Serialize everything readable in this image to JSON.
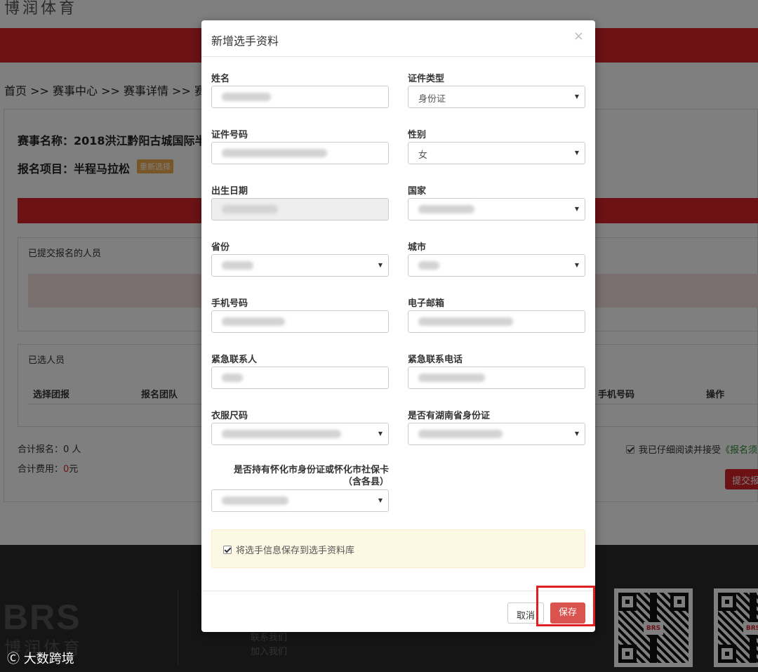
{
  "site": {
    "logo_top": "博润体育",
    "breadcrumb": "首页 >> 赛事中心 >> 赛事详情 >> 赛",
    "event_name": "赛事名称：2018洪江黔阳古城国际半",
    "event_item": "报名项目：半程马拉松",
    "reselect_label": "重新选择",
    "submitted_title": "已提交报名的人员",
    "selected_title": "已选人员",
    "table_headers": [
      "选择团报",
      "报名团队",
      "手机号码",
      "操作"
    ],
    "total_count": "合计报名：0 人",
    "total_fee_label": "合计费用：",
    "total_fee_value": "0",
    "total_fee_unit": "元",
    "agree_text": "我已仔细阅读并接受",
    "agree_link": "《报名须",
    "submit_label": "提交报",
    "footer_logo": "BRS",
    "footer_logo_cn": "博润体育",
    "footer_links": [
      "联系我们",
      "加入我们"
    ],
    "qr_badge": "BRS",
    "watermark": "大数跨境"
  },
  "modal": {
    "title": "新增选手资料",
    "close_icon": "×",
    "fields": {
      "name": {
        "label": "姓名"
      },
      "id_type": {
        "label": "证件类型",
        "value": "身份证"
      },
      "id_number": {
        "label": "证件号码"
      },
      "gender": {
        "label": "性别",
        "value": "女"
      },
      "birthdate": {
        "label": "出生日期"
      },
      "country": {
        "label": "国家"
      },
      "province": {
        "label": "省份"
      },
      "city": {
        "label": "城市"
      },
      "phone": {
        "label": "手机号码"
      },
      "email": {
        "label": "电子邮箱"
      },
      "emergency_contact": {
        "label": "紧急联系人"
      },
      "emergency_phone": {
        "label": "紧急联系电话"
      },
      "shirt_size": {
        "label": "衣服尺码"
      },
      "hunan_id": {
        "label": "是否有湖南省身份证"
      },
      "huaihua_id": {
        "label_line1": "是否持有怀化市身份证或怀化市社保卡",
        "label_line2": "（含各县）"
      }
    },
    "save_to_library": "将选手信息保存到选手资料库",
    "cancel_label": "取消",
    "save_label": "保存"
  }
}
